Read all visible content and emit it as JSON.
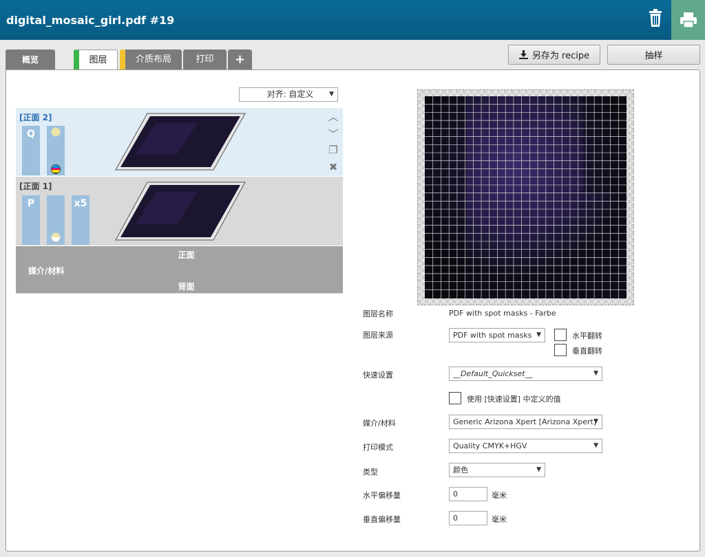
{
  "header": {
    "title": "digital_mosaic_girl.pdf #19"
  },
  "tabs": [
    {
      "label": "概览"
    },
    {
      "label": "图层"
    },
    {
      "label": "介质布局"
    },
    {
      "label": "打印"
    },
    {
      "label": "+"
    }
  ],
  "toolbar": {
    "save_recipe_label": "另存为 recipe",
    "sample_label": "抽样"
  },
  "align_select": {
    "value": "对齐: 自定义"
  },
  "layers": [
    {
      "title": "[正面 2]",
      "chip_letter": "Q"
    },
    {
      "title": "[正面 1]",
      "chip_letter": "P",
      "copies": "x5"
    }
  ],
  "media_bar": {
    "front_label": "正面",
    "media_label": "媒介/材料",
    "back_label": "背面"
  },
  "form": {
    "layer_name_label": "图层名称",
    "layer_name_value": "PDF with spot masks - Farbe",
    "layer_source_label": "图层来源",
    "layer_source_value": "PDF with spot masks",
    "flip_horizontal_label": "水平翻转",
    "flip_vertical_label": "垂直翻转",
    "quickset_label": "快速设置",
    "quickset_value": "__Default_Quickset__",
    "use_quickset_label": "使用 [快速设置] 中定义的值",
    "media_label": "媒介/材料",
    "media_value": "Generic Arizona Xpert [Arizona Xpert]",
    "print_mode_label": "打印模式",
    "print_mode_value": "Quality CMYK+HGV",
    "type_label": "类型",
    "type_value": "颜色",
    "h_offset_label": "水平偏移量",
    "h_offset_value": "0",
    "v_offset_label": "垂直偏移量",
    "v_offset_value": "0",
    "unit": "毫米"
  },
  "colors": {
    "header": "#0a6b98",
    "print_button": "#5fa88a",
    "layers_tab_accent": "#3ab54a",
    "media_tab_accent": "#f4c430"
  },
  "icons": {
    "trash": "trash-icon",
    "print": "printer-icon",
    "save": "download-icon",
    "up": "chevron-up-icon",
    "down": "chevron-down-icon",
    "copy": "copy-icon",
    "delete": "close-icon"
  }
}
